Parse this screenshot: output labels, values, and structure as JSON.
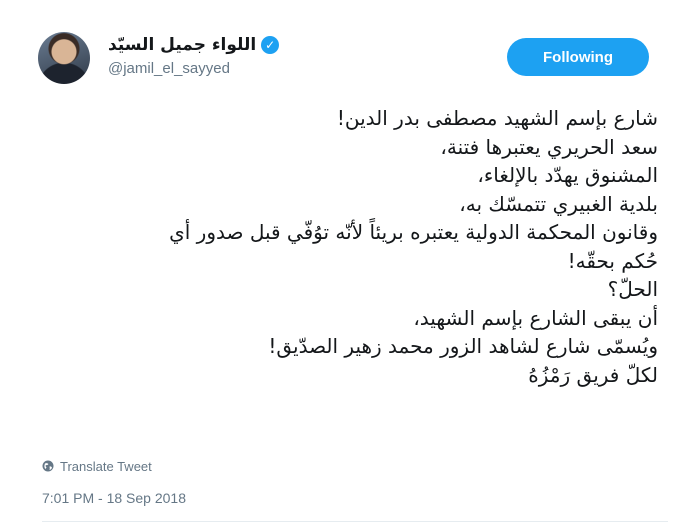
{
  "user": {
    "display_name": "اللواء جميل السيّد",
    "handle": "@jamil_el_sayyed",
    "verified_icon": "verified-badge-icon"
  },
  "follow_button": {
    "label": "Following"
  },
  "tweet": {
    "lines": [
      "شارع بإسم الشهيد مصطفى بدر الدين!",
      "سعد الحريري يعتبرها فتنة،",
      "المشنوق يهدّد بالإلغاء،",
      "بلدية الغبيري تتمسّك به،",
      "وقانون المحكمة الدولية يعتبره بريئاً لأنّه توُفّي قبل صدور أي",
      "حُكم بحقّه!",
      "الحلّ؟",
      "أن يبقى الشارع بإسم الشهيد،",
      "ويُسمّى شارع لشاهد الزور محمد زهير الصدّيق!",
      "لكلّ فريق رَمْزُهُ"
    ]
  },
  "translate": {
    "label": "Translate Tweet",
    "icon": "globe-icon"
  },
  "timestamp": "7:01 PM - 18 Sep 2018",
  "colors": {
    "accent": "#1da1f2",
    "secondary_text": "#657786",
    "text": "#14171a"
  }
}
